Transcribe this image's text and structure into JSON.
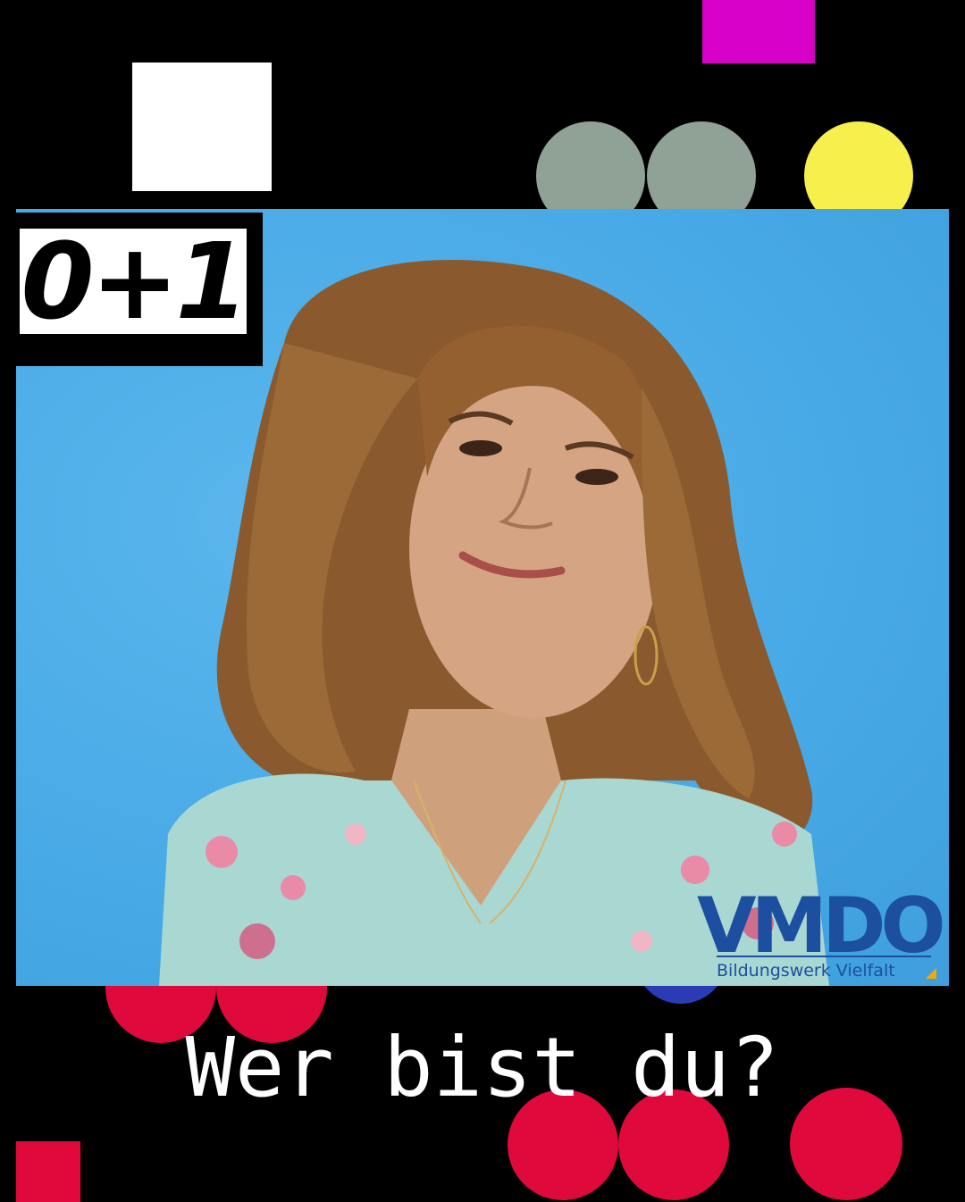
{
  "badge": {
    "text": "0+1"
  },
  "headline": {
    "text": "Wer bist du?"
  },
  "logo": {
    "name": "VMDO",
    "subtitle": "Bildungswerk Vielfalt"
  },
  "photo": {
    "subject": "portrait-photo"
  },
  "colors": {
    "background": "#000000",
    "photo_bg": "#4aaae6",
    "white": "#ffffff",
    "magenta": "#d600c9",
    "sage": "#8fa295",
    "yellow": "#f7ef4b",
    "red": "#e0093c",
    "blue": "#1c4fa0"
  }
}
